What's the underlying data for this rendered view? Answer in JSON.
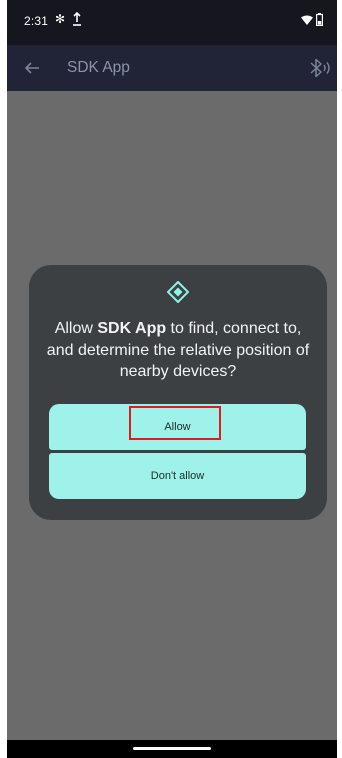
{
  "status_bar": {
    "time": "2:31",
    "bluetooth_icon": "bluetooth-icon",
    "upload_icon": "upload-icon",
    "wifi_icon": "wifi-icon",
    "battery_icon": "battery-icon"
  },
  "app_bar": {
    "title": "SDK App",
    "back_icon": "arrow-back-icon",
    "action_icon": "bluetooth-searching-icon",
    "background_color": "#212436"
  },
  "dialog": {
    "icon": "nearby-devices-icon",
    "message_prefix": "Allow ",
    "app_name": "SDK App",
    "message_suffix": " to find, connect to, and determine the relative position of nearby devices?",
    "allow_label": "Allow",
    "deny_label": "Don't allow",
    "button_color": "#9ef2ea",
    "background_color": "#3c4043",
    "highlight_color": "#e01b1b"
  }
}
